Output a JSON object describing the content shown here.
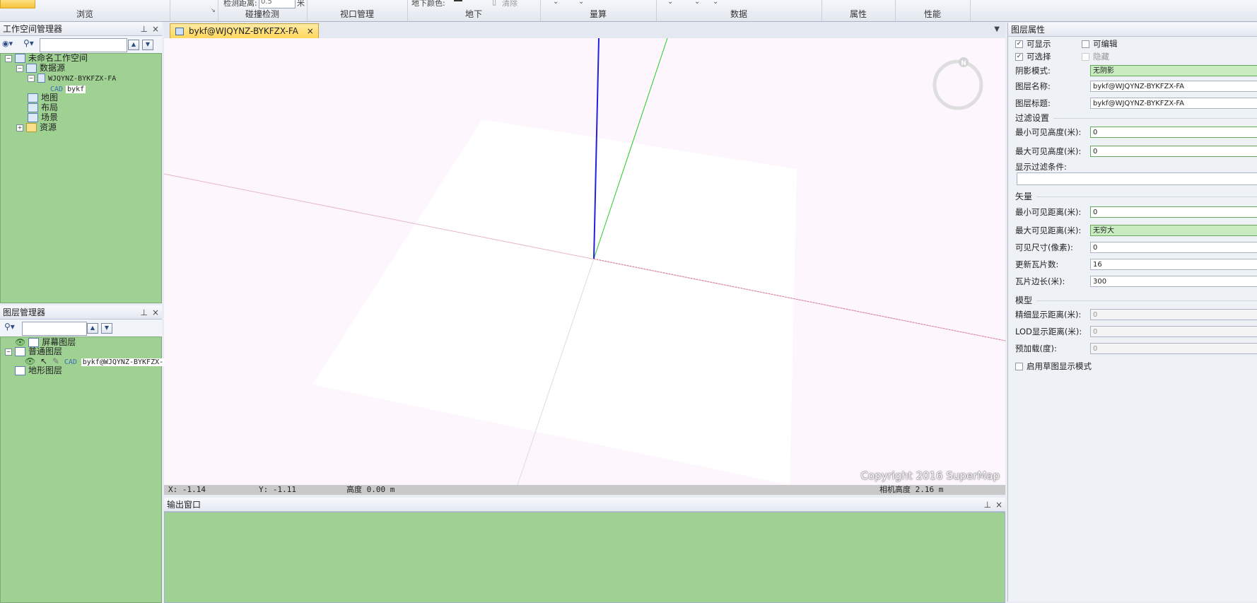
{
  "ribbon": {
    "groups": [
      "浏览",
      "碰撞检测",
      "视口管理",
      "地下",
      "量算",
      "数据",
      "属性",
      "性能"
    ],
    "detect_distance_label": "检测距离:",
    "detect_distance_value": "0.5",
    "detect_distance_unit": "米",
    "underground_color_label": "地下颜色:",
    "clear_label": "清除"
  },
  "workspace": {
    "title": "工作空间管理器",
    "search_placeholder": "",
    "tree": {
      "root": "未命名工作空间",
      "datasource": "数据源",
      "db_name": "WJQYNZ-BYKFZX-FA",
      "cad_tag": "CAD",
      "dataset": "bykf",
      "map": "地图",
      "layout": "布局",
      "scene": "场景",
      "resources": "资源"
    }
  },
  "layer_manager": {
    "title": "图层管理器",
    "screen_layers": "屏幕图层",
    "normal_layers": "普通图层",
    "cad_tag": "CAD",
    "layer_name": "bykf@WJQYNZ-BYKFZX-FA",
    "terrain_layers": "地形图层"
  },
  "document_tab": {
    "label": "bykf@WJQYNZ-BYKFZX-FA",
    "close": "×"
  },
  "scene": {
    "copyright": "Copyright 2016 SuperMap",
    "compass_label": "N",
    "status": {
      "x": "X: -1.14",
      "y": "Y: -1.11",
      "height": "高度 0.00 m",
      "camera_height": "相机高度 2.16 m"
    }
  },
  "output": {
    "title": "输出窗口"
  },
  "properties": {
    "title": "图层属性",
    "visible": "可显示",
    "editable": "可编辑",
    "selectable": "可选择",
    "hidden_partial": "隐藏",
    "shadow_mode_label": "阴影模式:",
    "shadow_mode_value": "无阴影",
    "layer_name_label": "图层名称:",
    "layer_name_value": "bykf@WJQYNZ-BYKFZX-FA",
    "layer_caption_label": "图层标题:",
    "layer_caption_value": "bykf@WJQYNZ-BYKFZX-FA",
    "filter_section": "过滤设置",
    "min_visible_height_label": "最小可见高度(米):",
    "min_visible_height_value": "0",
    "max_visible_height_label": "最大可见高度(米):",
    "max_visible_height_value": "0",
    "display_filter_label": "显示过滤条件:",
    "display_filter_value": "",
    "vector_section": "矢量",
    "min_visible_distance_label": "最小可见距离(米):",
    "min_visible_distance_value": "0",
    "max_visible_distance_label": "最大可见距离(米):",
    "max_visible_distance_value": "无穷大",
    "visible_size_label": "可见尺寸(像素):",
    "visible_size_value": "0",
    "update_tiles_label": "更新瓦片数:",
    "update_tiles_value": "16",
    "tile_side_label": "瓦片边长(米):",
    "tile_side_value": "300",
    "model_section": "模型",
    "fine_display_label": "精细显示距离(米):",
    "fine_display_value": "0",
    "lod_display_label": "LOD显示距离(米):",
    "lod_display_value": "0",
    "preload_label": "预加载(度):",
    "preload_value": "0",
    "sketch_mode_label": "启用草图显示模式"
  }
}
